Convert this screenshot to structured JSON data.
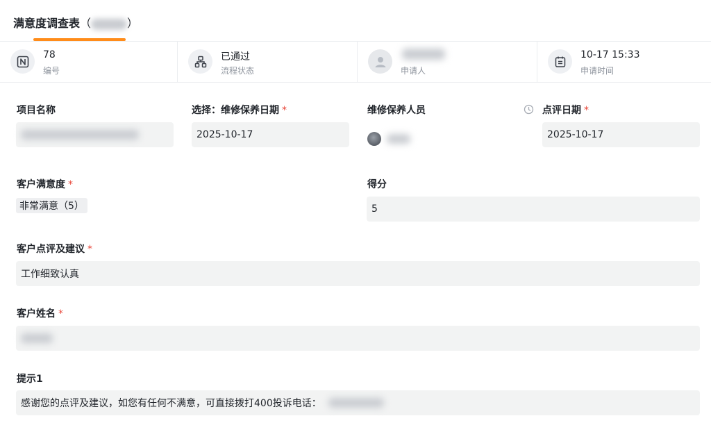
{
  "header": {
    "title": "满意度调查表",
    "title_open_paren": "（",
    "title_close_paren": "）"
  },
  "info_bar": {
    "number": {
      "value": "78",
      "label": "编号",
      "icon": "notion-n-icon"
    },
    "process": {
      "value": "已通过",
      "label": "流程状态",
      "icon": "flow-icon"
    },
    "applicant": {
      "value": "",
      "label": "申请人",
      "icon": "user-avatar-icon"
    },
    "apply_time": {
      "value": "10-17 15:33",
      "label": "申请时间",
      "icon": "calendar-icon"
    }
  },
  "form": {
    "project_name": {
      "label": "项目名称",
      "value": ""
    },
    "maintenance_date": {
      "label": "选择：维修保养日期",
      "required": "*",
      "value": "2025-10-17"
    },
    "maintenance_staff": {
      "label": "维修保养人员",
      "value": ""
    },
    "review_date": {
      "label": "点评日期",
      "required": "*",
      "value": "2025-10-17",
      "icon": "clock-icon"
    },
    "satisfaction": {
      "label": "客户满意度",
      "required": "*",
      "value": "非常满意（5）"
    },
    "score": {
      "label": "得分",
      "value": "5"
    },
    "comments": {
      "label": "客户点评及建议",
      "required": "*",
      "value": "工作细致认真"
    },
    "customer_name": {
      "label": "客户姓名",
      "required": "*",
      "value": ""
    },
    "hint": {
      "label": "提示1",
      "value": "感谢您的点评及建议，如您有任何不满意，可直接拨打400投诉电话："
    }
  },
  "colors": {
    "accent": "#ff8c1a",
    "required": "#e8483b",
    "field_bg": "#f2f3f3"
  }
}
